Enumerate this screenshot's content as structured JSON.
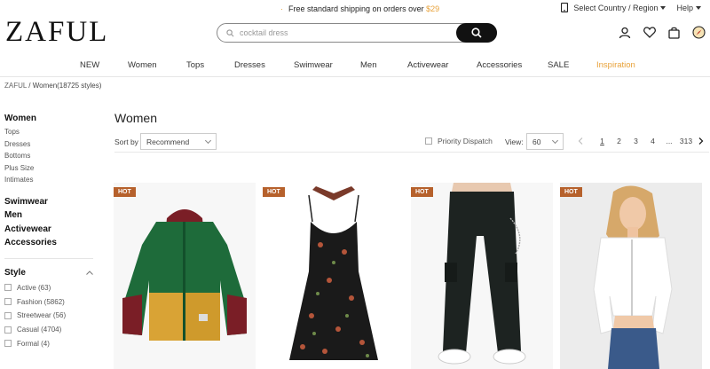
{
  "topbar": {
    "promo_text": "Free standard shipping on orders over ",
    "promo_amount": "$29",
    "country_label": "Select Country / Region",
    "help_label": "Help"
  },
  "header": {
    "logo": "ZAFUL",
    "search_placeholder": "cocktail dress"
  },
  "nav": {
    "items": [
      "NEW",
      "Women",
      "Tops",
      "Dresses",
      "Swimwear",
      "Men",
      "Activewear",
      "Accessories",
      "SALE",
      "Inspiration"
    ]
  },
  "breadcrumb": {
    "home": "ZAFUL",
    "separator": " / ",
    "current": "Women(18725 styles)"
  },
  "sidebar": {
    "heading": "Women",
    "subcategories": [
      "Tops",
      "Dresses",
      "Bottoms",
      "Plus Size",
      "Intimates"
    ],
    "categories": [
      "Swimwear",
      "Men",
      "Activewear",
      "Accessories"
    ],
    "style_heading": "Style",
    "style_filters": [
      "Active (63)",
      "Fashion (5862)",
      "Streetwear (56)",
      "Casual (4704)",
      "Formal (4)"
    ]
  },
  "main": {
    "title": "Women",
    "sort_label": "Sort by",
    "sort_value": "Recommend",
    "dispatch_label": "Priority Dispatch",
    "view_label": "View:",
    "view_value": "60",
    "pages": [
      "1",
      "2",
      "3",
      "4",
      "...",
      "313"
    ]
  },
  "products": [
    {
      "badge": "HOT",
      "image": "colorblock-hooded-jacket"
    },
    {
      "badge": "HOT",
      "image": "floral-cami-dress"
    },
    {
      "badge": "HOT",
      "image": "chain-cargo-pants"
    },
    {
      "badge": "HOT",
      "image": "white-crop-cardigan"
    }
  ],
  "colors": {
    "accent": "#e8a23a",
    "inspiration": "#e8a23a",
    "hot_badge": "#b6612c",
    "search_button": "#111111"
  }
}
